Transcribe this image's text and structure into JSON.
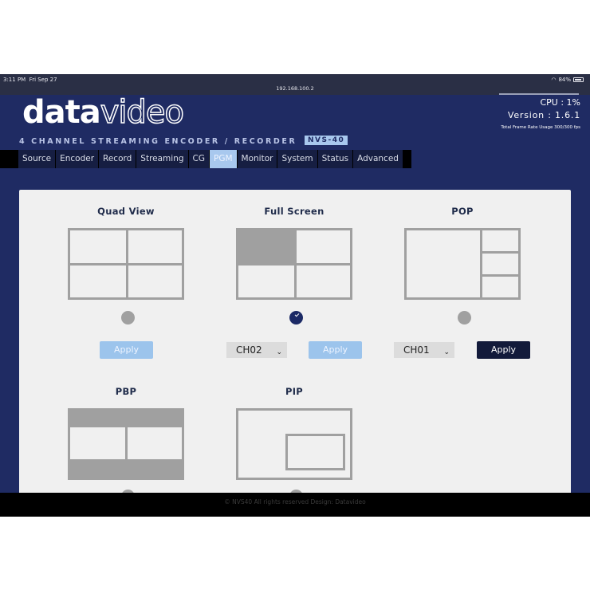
{
  "statusbar": {
    "time": "3:11 PM",
    "date": "Fri Sep 27",
    "url": "192.168.100.2",
    "wifi_icon": "wifi-icon",
    "battery": "84%",
    "battery_icon": "battery-icon"
  },
  "header": {
    "logo_bold": "data",
    "logo_light": "video",
    "tagline": "4 CHANNEL STREAMING ENCODER / RECORDER",
    "model": "NVS-40",
    "cpu": "CPU : 1%",
    "version": "Version : 1.6.1",
    "frame_rate": "Total Frame Rate Usage 300/300 fps"
  },
  "nav": {
    "tabs": [
      {
        "label": "Source"
      },
      {
        "label": "Encoder"
      },
      {
        "label": "Record"
      },
      {
        "label": "Streaming"
      },
      {
        "label": "CG"
      },
      {
        "label": "PGM",
        "active": true
      },
      {
        "label": "Monitor"
      },
      {
        "label": "System"
      },
      {
        "label": "Status"
      },
      {
        "label": "Advanced"
      }
    ]
  },
  "pgm": {
    "options": [
      {
        "title": "Quad View",
        "selected": false,
        "apply_label": "Apply",
        "apply_style": "light"
      },
      {
        "title": "Full Screen",
        "selected": true,
        "channel": "CH02",
        "apply_label": "Apply",
        "apply_style": "light"
      },
      {
        "title": "POP",
        "selected": false,
        "channel": "CH01",
        "apply_label": "Apply",
        "apply_style": "dark"
      },
      {
        "title": "PBP",
        "selected": false
      },
      {
        "title": "PIP",
        "selected": false
      }
    ]
  },
  "footer": {
    "text": "© NVS40 All rights reserved Design: Datavideo"
  },
  "colors": {
    "primary": "#1f2b63",
    "active_tab": "#a8c8ee",
    "apply_light": "#9cc4ec",
    "apply_dark": "#121a3a",
    "layout_stroke": "#a0a0a0"
  }
}
